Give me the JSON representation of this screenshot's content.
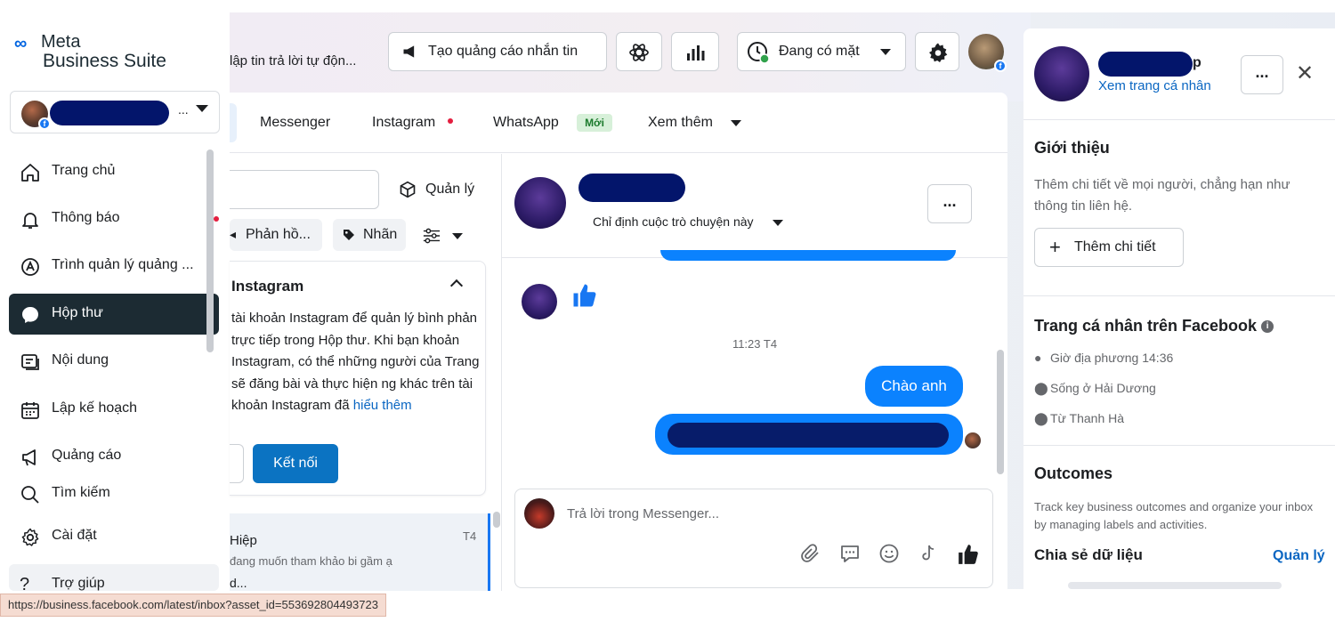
{
  "logo": {
    "line1": "Meta",
    "line2": "Business Suite"
  },
  "account": {
    "dots": "..."
  },
  "sidebar": {
    "items": [
      {
        "label": "Trang chủ",
        "icon": "home-icon"
      },
      {
        "label": "Thông báo",
        "icon": "bell-icon"
      },
      {
        "label": "Trình quản lý quảng ...",
        "icon": "ads-manager-icon"
      },
      {
        "label": "Hộp thư",
        "icon": "chat-bubble-icon"
      },
      {
        "label": "Nội dung",
        "icon": "content-icon"
      },
      {
        "label": "Lập kế hoạch",
        "icon": "calendar-icon"
      },
      {
        "label": "Quảng cáo",
        "icon": "megaphone-icon"
      },
      {
        "label": "Tìm kiếm",
        "icon": "search-icon"
      },
      {
        "label": "Cài đặt",
        "icon": "gear-icon"
      },
      {
        "label": "Trợ giúp",
        "icon": "help-icon"
      }
    ]
  },
  "header": {
    "automation_text": "lập tin trả lời tự độn...",
    "create_ad_label": "Tạo quảng cáo nhắn tin",
    "status_label": "Đang có mặt"
  },
  "tabs": [
    {
      "label": "Messenger"
    },
    {
      "label": "Instagram"
    },
    {
      "label": "WhatsApp"
    },
    {
      "label": "Xem thêm"
    }
  ],
  "new_badge": "Mới",
  "filters": {
    "manage_label": "Quản lý",
    "reply_label": "Phản hồ...",
    "label_label": "Nhãn"
  },
  "instagram_card": {
    "title": "Instagram",
    "body": "tài khoản Instagram để quản lý bình phản trực tiếp trong Hộp thư. Khi bạn khoản Instagram, có thể những người của Trang sẽ đăng bài và thực hiện ng khác trên tài khoản Instagram đã",
    "link": "hiểu thêm",
    "connect_label": "Kết nối"
  },
  "conversation": {
    "name": "Hiệp",
    "time": "T4",
    "snippet": "đang muốn tham khảo bi gầm ạ",
    "snippet2": "d..."
  },
  "chat": {
    "assign_label": "Chỉ định cuộc trò chuyện này",
    "more_label": "...",
    "time_divider": "11:23 T4",
    "message1": "Chào anh",
    "composer_placeholder": "Trả lời trong Messenger..."
  },
  "right_panel": {
    "name_suffix": "p",
    "view_profile": "Xem trang cá nhân",
    "more_label": "...",
    "intro_title": "Giới thiệu",
    "intro_text": "Thêm chi tiết về mọi người, chẳng hạn như thông tin liên hệ.",
    "add_details": "Thêm chi tiết",
    "fb_profile_title": "Trang cá nhân trên Facebook",
    "local_time": "Giờ địa phương 14:36",
    "lives_in": "Sống ở Hải Dương",
    "from": "Từ Thanh Hà",
    "outcomes_title": "Outcomes",
    "outcomes_text": "Track key business outcomes and organize your inbox by managing labels and activities.",
    "share_data_title": "Chia sẻ dữ liệu",
    "manage_label": "Quản lý"
  },
  "statusbar": {
    "url": "https://business.facebook.com/latest/inbox?asset_id=553692804493723"
  },
  "colors": {
    "accent": "#0b82fe",
    "brand": "#0064e0",
    "active_nav": "#1c2b33",
    "connect": "#0b73c2"
  }
}
